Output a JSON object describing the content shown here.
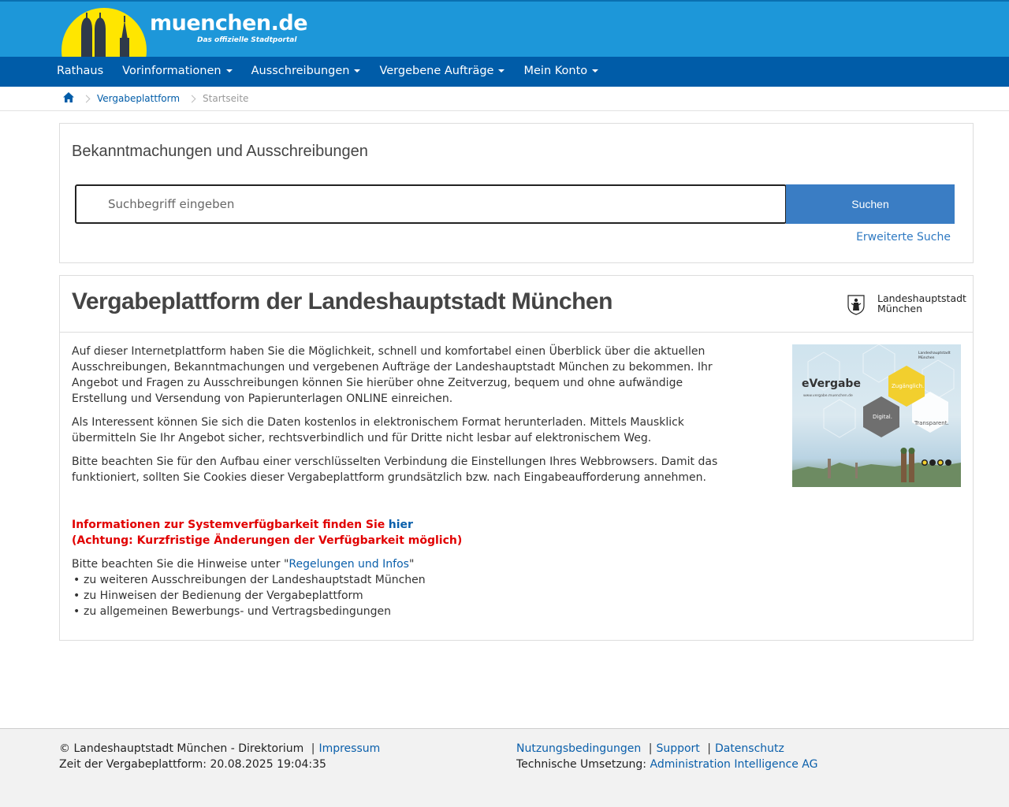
{
  "header": {
    "logo_text": "muenchen.de",
    "logo_subtitle": "Das offizielle Stadtportal"
  },
  "nav": {
    "items": [
      {
        "label": "Rathaus",
        "dropdown": false
      },
      {
        "label": "Vorinformationen",
        "dropdown": true
      },
      {
        "label": "Ausschreibungen",
        "dropdown": true
      },
      {
        "label": "Vergebene Aufträge",
        "dropdown": true
      },
      {
        "label": "Mein Konto",
        "dropdown": true
      }
    ]
  },
  "breadcrumb": {
    "icon": "home-icon",
    "link": "Vergabeplattform",
    "current": "Startseite"
  },
  "search": {
    "title": "Bekanntmachungen und Ausschreibungen",
    "placeholder": "Suchbegriff eingeben",
    "button": "Suchen",
    "advanced": "Erweiterte Suche"
  },
  "main": {
    "title": "Vergabeplattform der Landeshauptstadt München",
    "logo_line1": "Landeshauptstadt",
    "logo_line2": "München",
    "paragraphs": [
      "Auf dieser Internetplattform haben Sie die Möglichkeit, schnell und komfortabel einen Überblick über die aktuellen Ausschreibungen, Bekanntmachungen und vergebenen Aufträge der Landeshauptstadt München zu bekommen. Ihr Angebot und Fragen zu Ausschreibungen können Sie hierüber ohne Zeitverzug, bequem und ohne aufwändige Erstellung und Versendung von Papierunterlagen ONLINE einreichen.",
      "Als Interessent können Sie sich die Daten kostenlos in elektronischem Format herunterladen. Mittels Mausklick übermitteln Sie Ihr Angebot sicher, rechtsverbindlich und für Dritte nicht lesbar auf elektronischem Weg.",
      "Bitte beachten Sie für den Aufbau einer verschlüsselten Verbindung die Einstellungen Ihres Webbrowsers. Damit das funktioniert, sollten Sie Cookies dieser Vergabeplattform grundsätzlich bzw. nach Eingabeaufforderung annehmen."
    ],
    "availability_text": "Informationen zur Systemverfügbarkeit finden Sie",
    "availability_link": "hier",
    "availability_note": "(Achtung: Kurzfristige Änderungen der Verfügbarkeit möglich)",
    "hint_prefix": "Bitte beachten Sie die Hinweise unter \"",
    "hint_link": "Regelungen und Infos",
    "hint_suffix": "\"",
    "hint_items": [
      "zu weiteren Ausschreibungen der Landeshauptstadt München",
      "zu Hinweisen der Bedienung der Vergabeplattform",
      "zu allgemeinen Bewerbungs- und Vertragsbedingungen"
    ],
    "promo": {
      "brand": "eVergabe",
      "tag1": "Zugänglich.",
      "tag2": "Digital.",
      "tag3": "Transparent.",
      "corner": "Landeshauptstadt München",
      "url": "www.vergabe.muenchen.de"
    }
  },
  "footer": {
    "copyright": "© Landeshauptstadt München - Direktorium",
    "impressum": "Impressum",
    "time_label": "Zeit der Vergabeplattform: 20.08.2025 19:04:35",
    "nutzung": "Nutzungsbedingungen",
    "support": "Support",
    "datenschutz": "Datenschutz",
    "tech_label": "Technische Umsetzung:",
    "tech_link": "Administration Intelligence AG"
  },
  "colors": {
    "header_blue": "#1d97d9",
    "nav_blue": "#005ca8",
    "sun_yellow": "#ffe600",
    "button_blue": "#3a7dc4",
    "warning_red": "#e10000"
  }
}
